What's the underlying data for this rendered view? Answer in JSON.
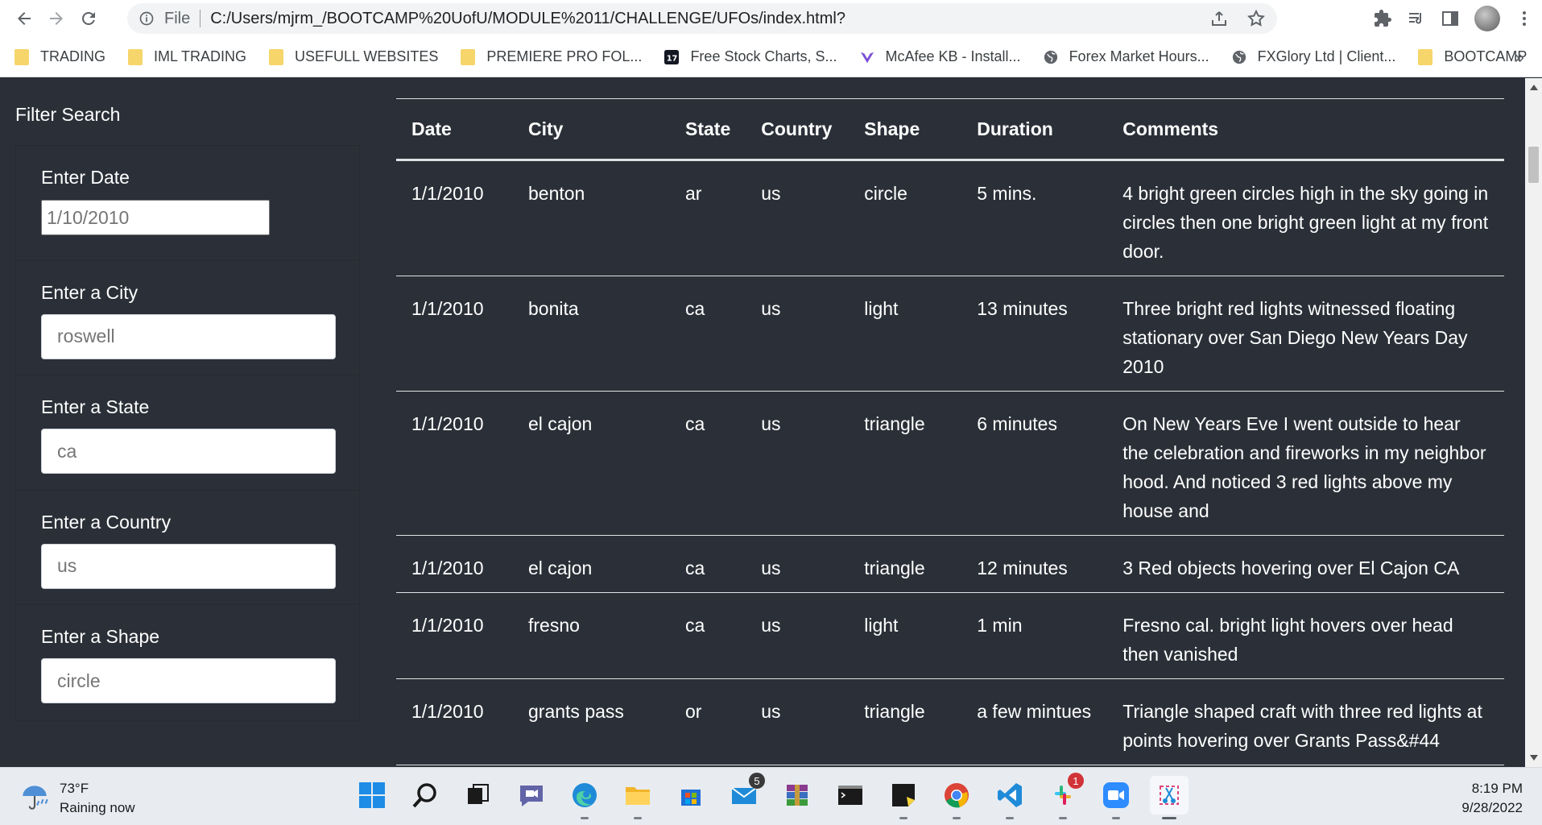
{
  "browser": {
    "file_label": "File",
    "url": "C:/Users/mjrm_/BOOTCAMP%20UofU/MODULE%2011/CHALLENGE/UFOs/index.html?",
    "bookmarks": [
      {
        "label": "TRADING",
        "icon": "folder-icon"
      },
      {
        "label": "IML TRADING",
        "icon": "folder-icon"
      },
      {
        "label": "USEFULL WEBSITES",
        "icon": "folder-icon"
      },
      {
        "label": "PREMIERE PRO FOL...",
        "icon": "folder-icon"
      },
      {
        "label": "Free Stock Charts, S...",
        "icon": "tradingview-icon"
      },
      {
        "label": "McAfee KB - Install...",
        "icon": "mcafee-icon"
      },
      {
        "label": "Forex Market Hours...",
        "icon": "globe-icon"
      },
      {
        "label": "FXGlory Ltd | Client...",
        "icon": "globe-icon"
      },
      {
        "label": "BOOTCAMP",
        "icon": "folder-icon"
      }
    ],
    "bookmarks_more": "»"
  },
  "filter": {
    "title": "Filter Search",
    "fields": [
      {
        "label": "Enter Date",
        "value": "",
        "placeholder": "1/10/2010"
      },
      {
        "label": "Enter a City",
        "value": "",
        "placeholder": "roswell"
      },
      {
        "label": "Enter a State",
        "value": "",
        "placeholder": "ca"
      },
      {
        "label": "Enter a Country",
        "value": "",
        "placeholder": "us"
      },
      {
        "label": "Enter a Shape",
        "value": "",
        "placeholder": "circle"
      }
    ]
  },
  "table": {
    "headers": [
      "Date",
      "City",
      "State",
      "Country",
      "Shape",
      "Duration",
      "Comments"
    ],
    "rows": [
      [
        "1/1/2010",
        "benton",
        "ar",
        "us",
        "circle",
        "5 mins.",
        "4 bright green circles high in the sky going in circles then one bright green light at my front door."
      ],
      [
        "1/1/2010",
        "bonita",
        "ca",
        "us",
        "light",
        "13 minutes",
        "Three bright red lights witnessed floating stationary over San Diego New Years Day 2010"
      ],
      [
        "1/1/2010",
        "el cajon",
        "ca",
        "us",
        "triangle",
        "6 minutes",
        "On New Years Eve I went outside to hear the celebration and fireworks in my neighbor hood. And noticed 3 red lights above my house and"
      ],
      [
        "1/1/2010",
        "el cajon",
        "ca",
        "us",
        "triangle",
        "12 minutes",
        "3 Red objects hovering over El Cajon CA"
      ],
      [
        "1/1/2010",
        "fresno",
        "ca",
        "us",
        "light",
        "1 min",
        "Fresno cal. bright light hovers over head then vanished"
      ],
      [
        "1/1/2010",
        "grants pass",
        "or",
        "us",
        "triangle",
        "a few mintues",
        "Triangle shaped craft with three red lights at points hovering over Grants Pass&#44"
      ]
    ]
  },
  "taskbar": {
    "weather_temp": "73°F",
    "weather_desc": "Raining now",
    "mail_badge": "5",
    "slack_badge": "1",
    "time": "8:19 PM",
    "date": "9/28/2022"
  }
}
